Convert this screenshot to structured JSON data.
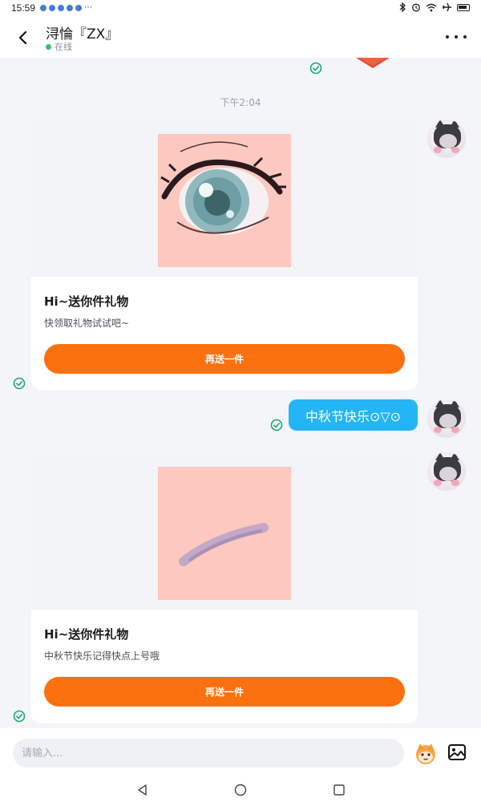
{
  "status_bar": {
    "time": "15:59",
    "overflow": "⋯"
  },
  "header": {
    "contact_name": "浔惀『ZX』",
    "presence_text": "在线"
  },
  "chat": {
    "timestamp": "下午2:04",
    "messages": [
      {
        "type": "gift",
        "title": "Hi~送你件礼物",
        "description": "快领取礼物试试吧~",
        "button_label": "再送一件"
      },
      {
        "type": "text",
        "text": "中秋节快乐⊙▽⊙"
      },
      {
        "type": "gift",
        "title": "Hi~送你件礼物",
        "description": "中秋节快乐记得快点上号哦",
        "button_label": "再送一件"
      }
    ]
  },
  "input_bar": {
    "placeholder": "请输入..."
  },
  "colors": {
    "accent_orange": "#fb700f",
    "bubble_blue": "#23b5f5",
    "check_green": "#1fa86a"
  }
}
